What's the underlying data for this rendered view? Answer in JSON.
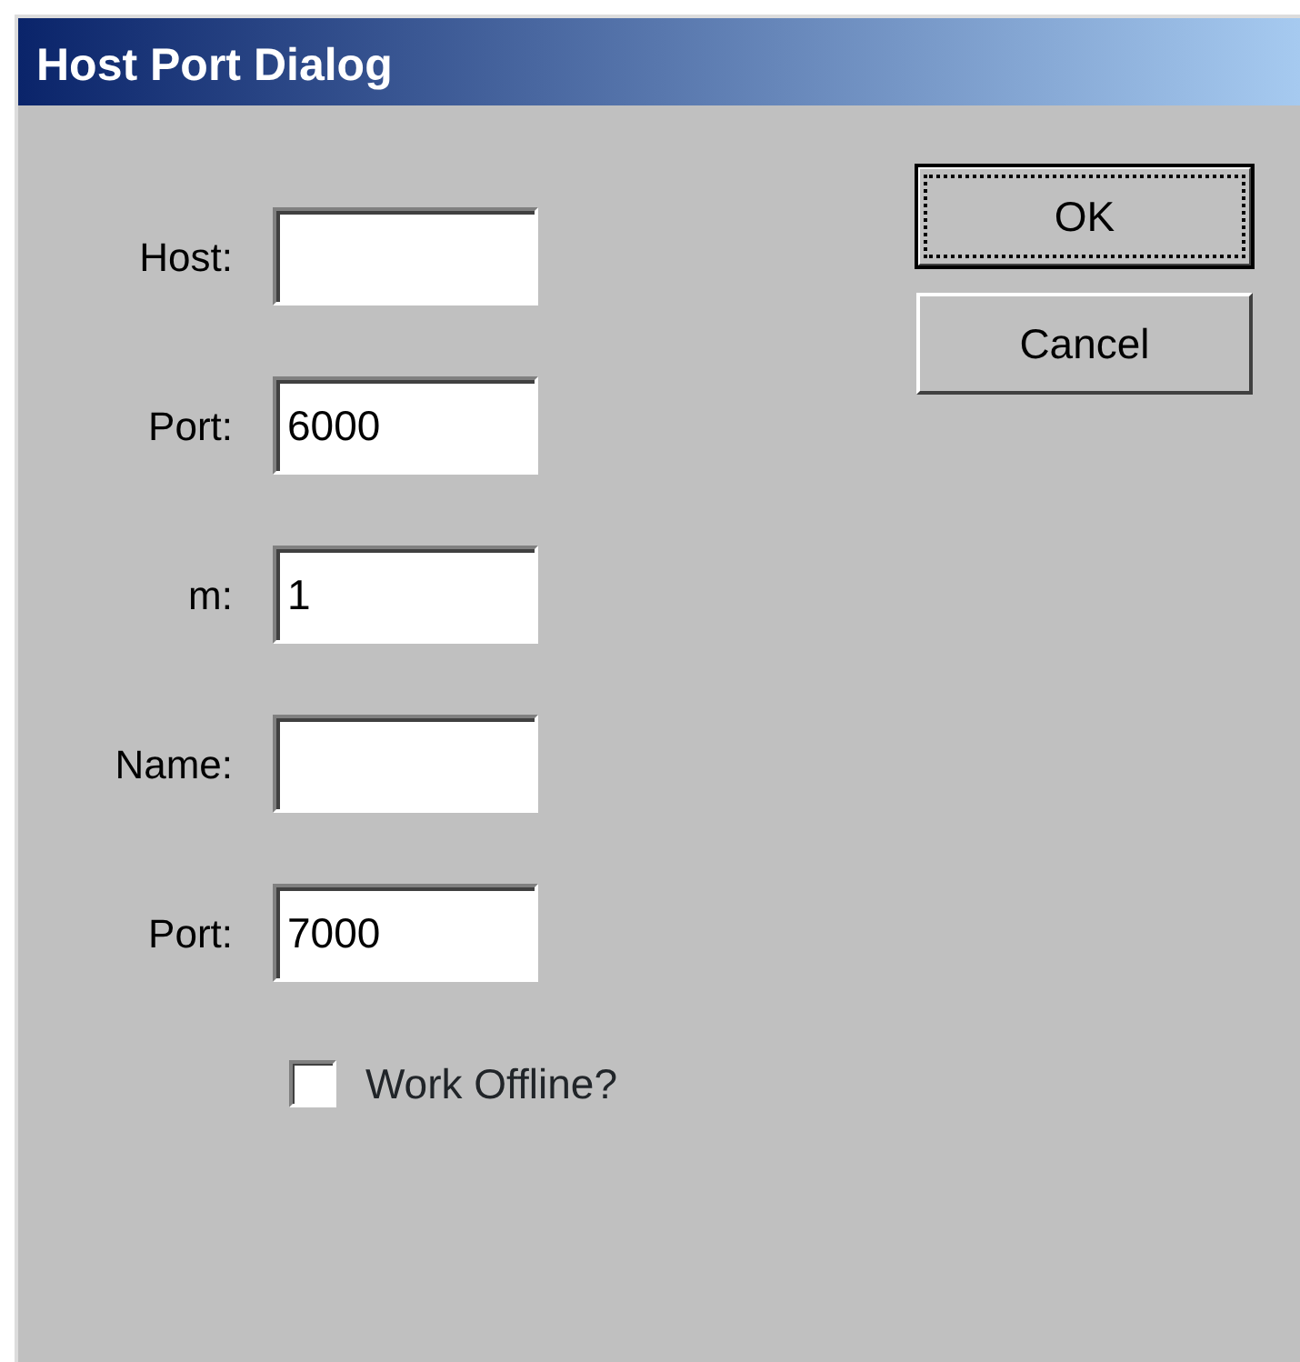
{
  "window": {
    "title": "Host Port Dialog"
  },
  "fields": [
    {
      "label": "Host:"
    },
    {
      "label": "Port:",
      "value": "6000"
    },
    {
      "label": "m:",
      "value": "1"
    },
    {
      "label": "Name:"
    },
    {
      "label": "Port:",
      "value": "7000"
    }
  ],
  "checkbox": {
    "label": "Work Offline?",
    "checked": false
  },
  "buttons": [
    {
      "label": "OK",
      "default": true
    },
    {
      "label": "Cancel",
      "default": false
    }
  ]
}
